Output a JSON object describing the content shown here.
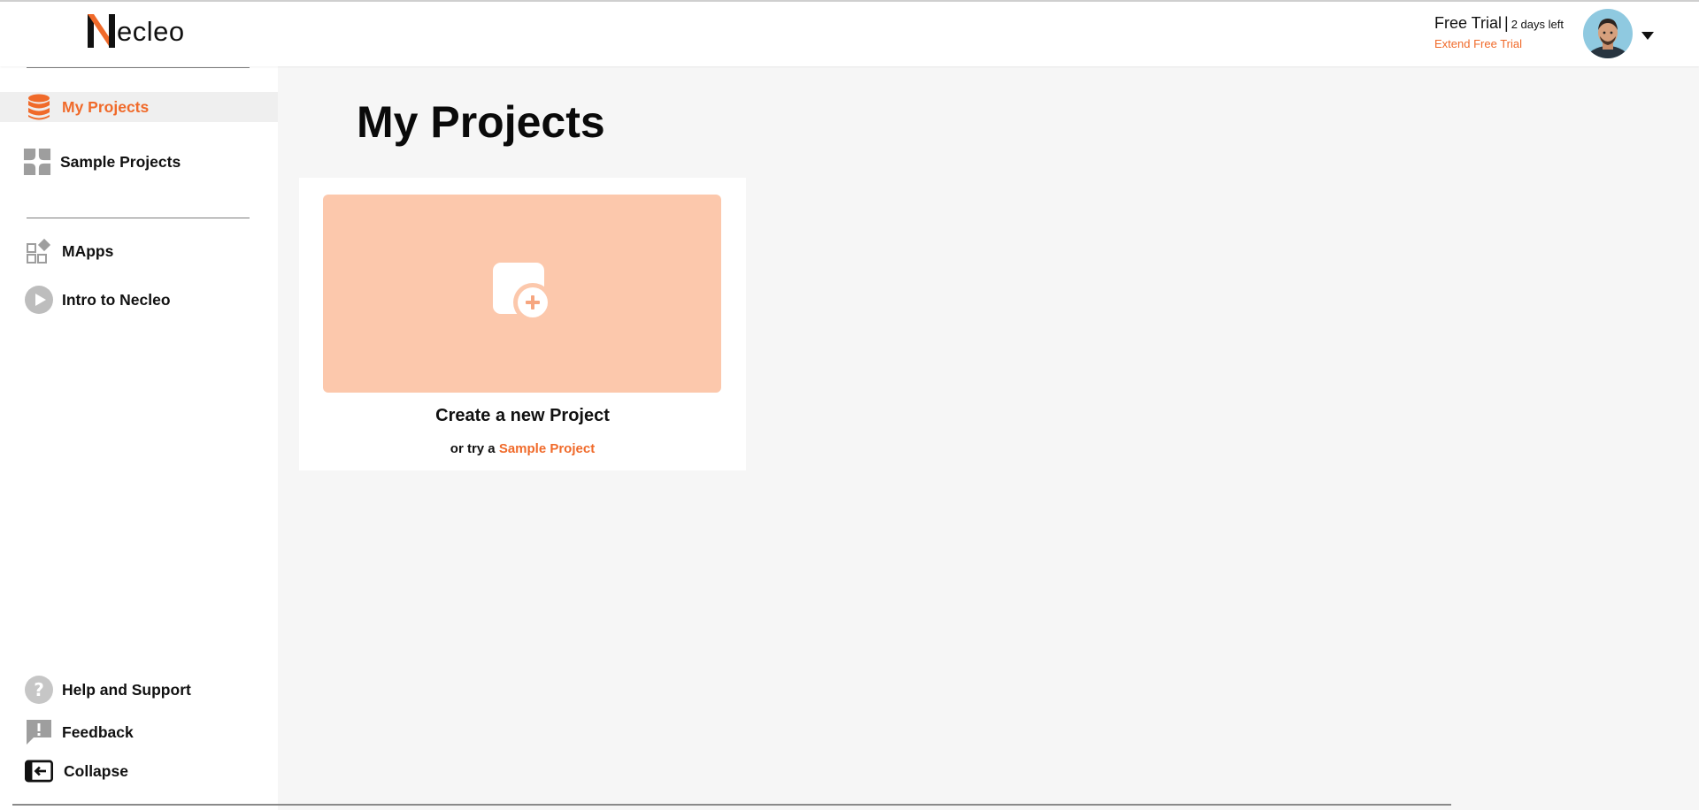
{
  "brand": {
    "logo_text": "ecleo",
    "accent": "#f06a2a"
  },
  "sidebar": {
    "top_items": [
      {
        "label": "My Projects",
        "icon": "database-icon",
        "active": true
      },
      {
        "label": "Sample Projects",
        "icon": "sample-grid-icon",
        "active": false
      }
    ],
    "mid_items": [
      {
        "label": "MApps",
        "icon": "apps-icon"
      },
      {
        "label": "Intro to Necleo",
        "icon": "play-icon"
      }
    ],
    "bottom_items": [
      {
        "label": "Help and Support",
        "icon": "help-icon"
      },
      {
        "label": "Feedback",
        "icon": "feedback-icon"
      },
      {
        "label": "Collapse",
        "icon": "collapse-icon"
      }
    ]
  },
  "header": {
    "trial_label": "Free Trial",
    "trial_sep": "|",
    "trial_days": "2 days left",
    "extend_label": "Extend Free Trial"
  },
  "main": {
    "title": "My Projects",
    "create_title": "Create a new Project",
    "create_sub_prefix": "or try a",
    "create_sub_link": "Sample Project"
  }
}
